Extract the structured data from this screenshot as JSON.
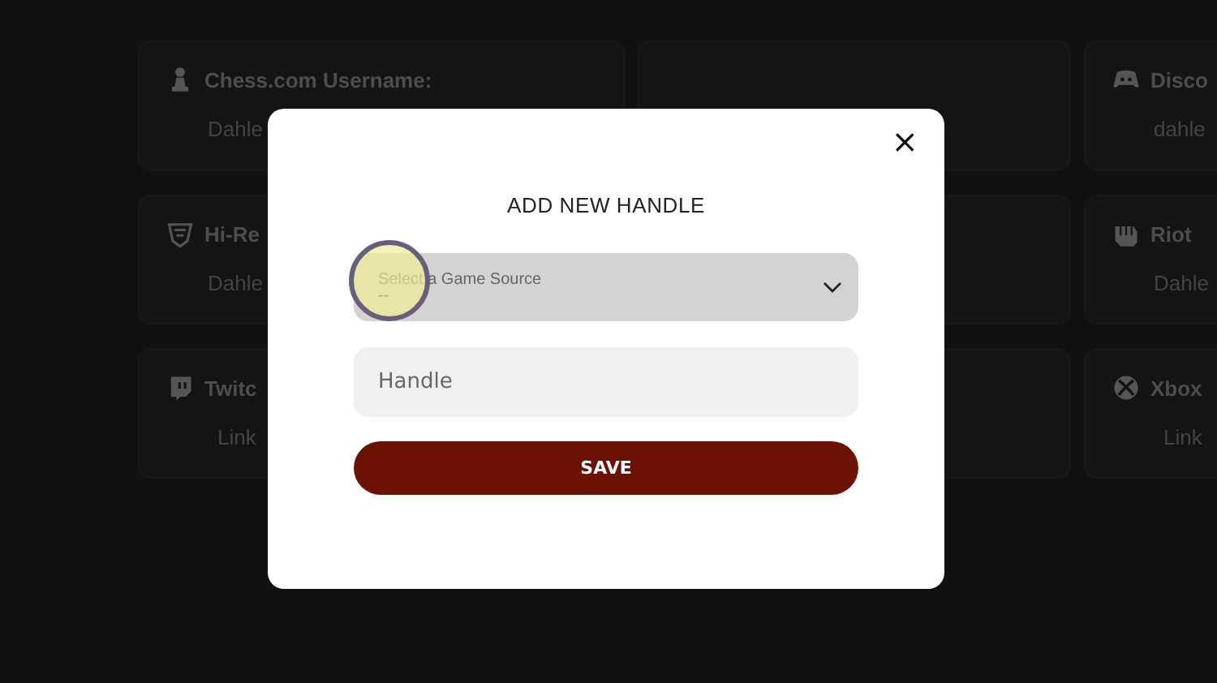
{
  "left_cards": [
    {
      "kind": "text",
      "title": "Chess.com Username:",
      "value": "Dahle"
    },
    {
      "kind": "text",
      "title": "Hi-Re",
      "value": "Dahle"
    },
    {
      "kind": "link",
      "title": "Twitc",
      "value": "Link"
    }
  ],
  "right_cards": [
    {
      "kind": "text",
      "title": "Disco",
      "value": "dahle"
    },
    {
      "kind": "text",
      "title": "Riot",
      "value": "Dahle"
    },
    {
      "kind": "link",
      "title": "Xbox",
      "value": "Link"
    }
  ],
  "modal": {
    "title": "ADD NEW HANDLE",
    "close": "×",
    "select": {
      "label": "Select a Game Source",
      "value": "--"
    },
    "handle": {
      "placeholder": "Handle"
    },
    "save": "SAVE"
  }
}
